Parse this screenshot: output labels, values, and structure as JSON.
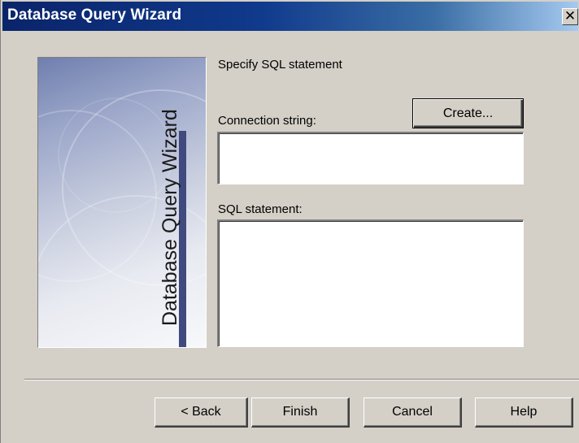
{
  "window": {
    "title": "Database Query Wizard",
    "close_glyph": "✕"
  },
  "side_panel": {
    "title": "Database Query Wizard"
  },
  "content": {
    "heading": "Specify SQL statement",
    "connection_label": "Connection string:",
    "connection_value": "",
    "create_button": "Create...",
    "sql_label": "SQL statement:",
    "sql_value": ""
  },
  "footer": {
    "back": "< Back",
    "finish": "Finish",
    "cancel": "Cancel",
    "help": "Help"
  },
  "colors": {
    "titlebar": "#0a246a",
    "dialog_face": "#d4d0c8",
    "panel_accent": "#404a7e"
  }
}
